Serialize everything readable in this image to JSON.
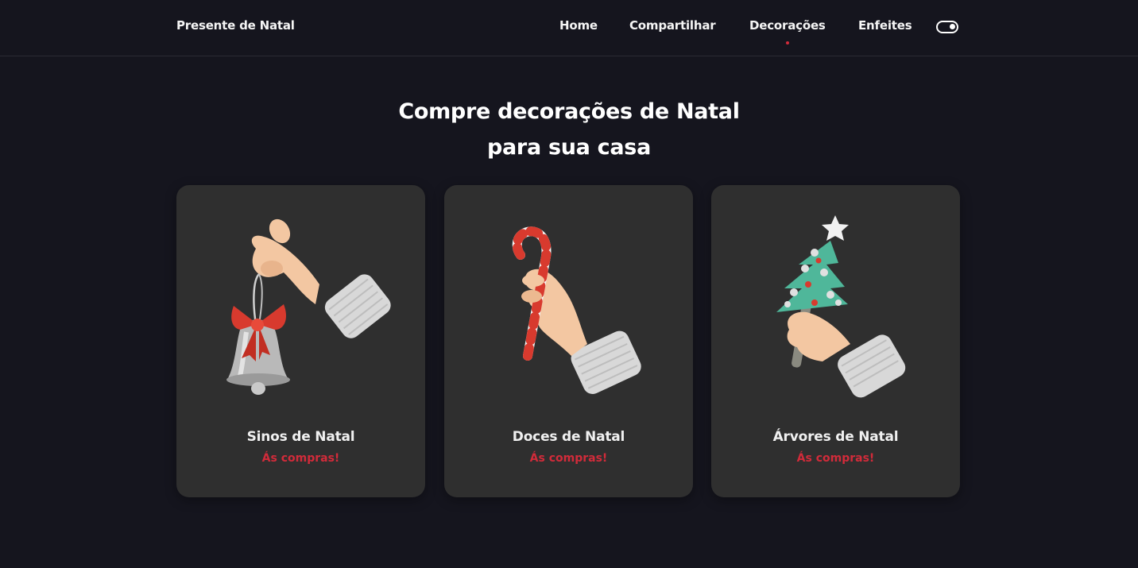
{
  "header": {
    "logo": "Presente de Natal",
    "nav": [
      {
        "label": "Home",
        "active": false
      },
      {
        "label": "Compartilhar",
        "active": false
      },
      {
        "label": "Decorações",
        "active": true
      },
      {
        "label": "Enfeites",
        "active": false
      }
    ],
    "toggle_icon": "toggle-switch-icon"
  },
  "main": {
    "title_line1": "Compre decorações de Natal",
    "title_line2": "para sua casa"
  },
  "cards": [
    {
      "title": "Sinos de Natal",
      "cta": "Ás compras!",
      "image": "hand-holding-bell"
    },
    {
      "title": "Doces de Natal",
      "cta": "Ás compras!",
      "image": "hand-holding-candy-cane"
    },
    {
      "title": "Árvores de Natal",
      "cta": "Ás compras!",
      "image": "hand-holding-christmas-tree"
    }
  ],
  "colors": {
    "background": "#15151e",
    "card": "#2f2f2f",
    "accent": "#d22b3a",
    "text": "#ffffff"
  }
}
